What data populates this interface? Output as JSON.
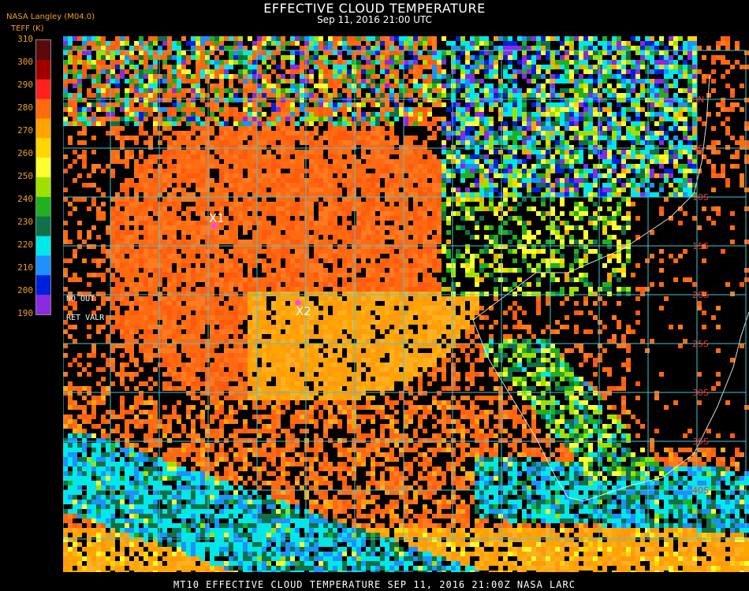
{
  "header": {
    "title": "EFFECTIVE CLOUD TEMPERATURE",
    "subtitle": "Sep 11, 2016 21:00 UTC",
    "source": "NASA Langley (M04.0)",
    "unit_label": "TEFF (K)"
  },
  "colorbar": {
    "ticks": [
      "310",
      "300",
      "290",
      "280",
      "270",
      "260",
      "250",
      "240",
      "230",
      "220",
      "210",
      "200",
      "190"
    ],
    "colors": [
      "#5a0a0a",
      "#a00000",
      "#ff2020",
      "#ff6a10",
      "#ffa500",
      "#ffd700",
      "#ffff30",
      "#a0e000",
      "#20b020",
      "#10704a",
      "#00e8e8",
      "#1e90ff",
      "#0020e0",
      "#8a2be2"
    ]
  },
  "map_legend": {
    "no_out": "NO   OUT",
    "ret_valr": "RET  VALR"
  },
  "markers": [
    {
      "label": "X1",
      "color": "#ff40ff"
    },
    {
      "label": "X2",
      "color": "#ff40ff"
    }
  ],
  "lat_labels": [
    "0N",
    "5S",
    "10S",
    "15S",
    "20S",
    "25S",
    "30S",
    "35S",
    "40S"
  ],
  "grid_color": "#40c8d8",
  "footer": "MT10  EFFECTIVE CLOUD TEMPERATURE   SEP 11, 2016 21:00Z   NASA LARC"
}
